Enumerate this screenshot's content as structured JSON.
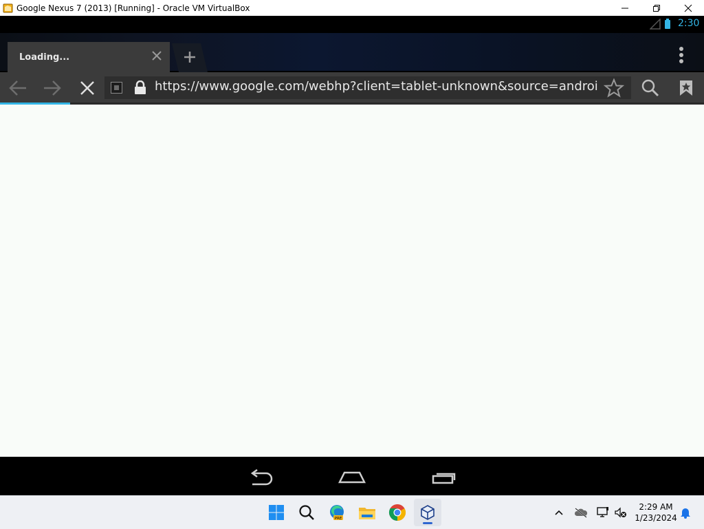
{
  "window": {
    "title": "Google Nexus 7 (2013) [Running] - Oracle VM VirtualBox",
    "controls": [
      "minimize",
      "restore",
      "close"
    ]
  },
  "android_status": {
    "time": "2:30",
    "icons": [
      "signal-icon",
      "battery-icon"
    ]
  },
  "browser": {
    "tabs": [
      {
        "label": "Loading...",
        "active": true
      }
    ],
    "new_tab_icon": "plus-icon",
    "menu_icon": "overflow-menu-icon",
    "toolbar": {
      "back_icon": "back-arrow-icon",
      "forward_icon": "forward-arrow-icon",
      "stop_icon": "stop-x-icon"
    },
    "url": "https://www.google.com/webhp?client=tablet-unknown&source=android-",
    "page_loading_progress": 0.1,
    "accent_color": "#33b5e5"
  },
  "android_nav": [
    "back-icon",
    "home-icon",
    "recents-icon"
  ],
  "taskbar": {
    "apps": [
      "start-icon",
      "search-icon",
      "edge-beta-icon",
      "file-explorer-icon",
      "chrome-icon",
      "virtualbox-icon"
    ],
    "active_app": "virtualbox-icon",
    "time": "2:29 AM",
    "date": "1/23/2024"
  }
}
